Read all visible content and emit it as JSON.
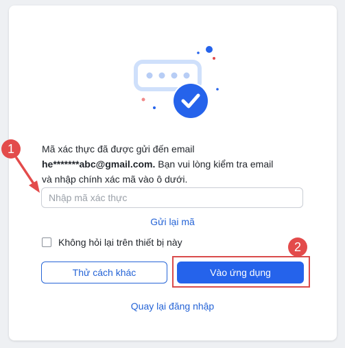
{
  "message": {
    "line1": "Mã xác thực đã được gửi đến email",
    "email": "he*******abc@gmail.com.",
    "line2_rest": " Bạn vui lòng kiểm tra email",
    "line3": "và nhập chính xác mã vào ô dưới."
  },
  "code_input": {
    "placeholder": "Nhập mã xác thực",
    "value": ""
  },
  "resend_label": "Gửi lại mã",
  "remember_label": "Không hỏi lại trên thiết bị này",
  "buttons": {
    "other_method": "Thử cách khác",
    "enter_app": "Vào ứng dụng"
  },
  "back_to_login": "Quay lại đăng nhập",
  "annotations": {
    "step1": "1",
    "step2": "2"
  },
  "colors": {
    "accent": "#2563eb",
    "link": "#2463d6",
    "annotation": "#e34b4b",
    "illustration_light": "#cfe0fb"
  }
}
